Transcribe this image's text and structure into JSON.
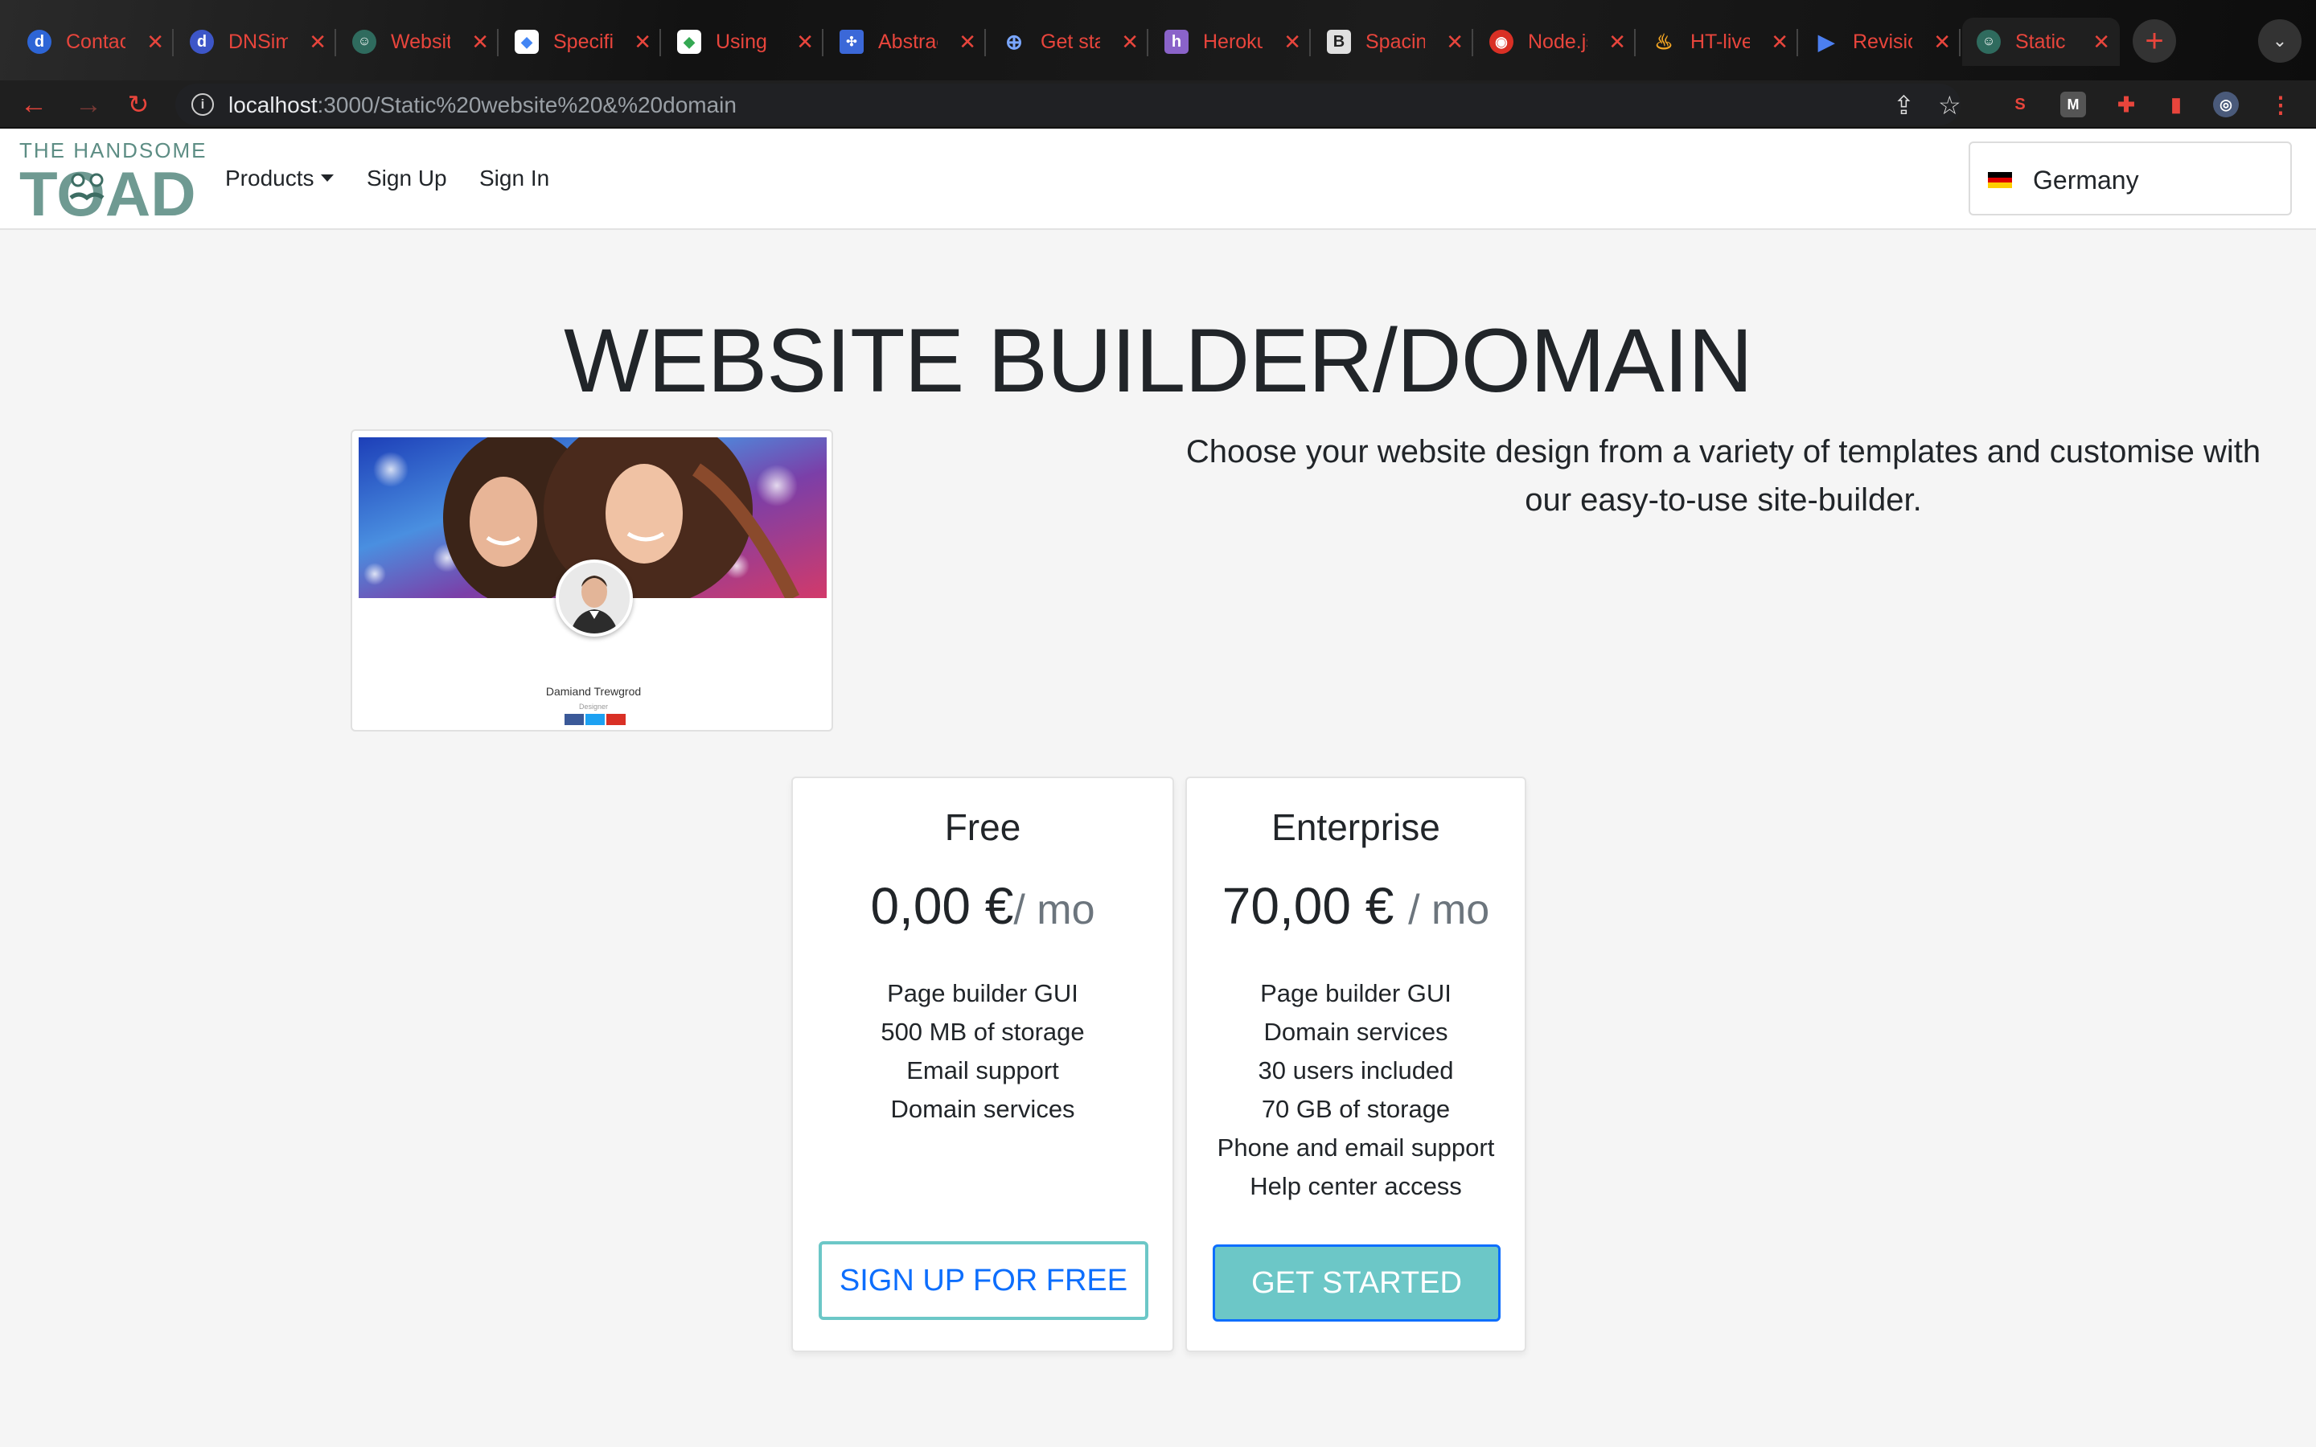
{
  "browser": {
    "tabs": [
      {
        "title": "Contact",
        "favicon": "d",
        "favicon_color": "#2d65d6"
      },
      {
        "title": "DNSimple",
        "favicon": "d",
        "favicon_color": "#3d56c8"
      },
      {
        "title": "Website",
        "favicon": "toad",
        "favicon_color": "#2f6b5e"
      },
      {
        "title": "Specification",
        "favicon": "g",
        "favicon_color": "#ffffff"
      },
      {
        "title": "Using",
        "favicon": "g",
        "favicon_color": "#ffffff"
      },
      {
        "title": "Abstract",
        "favicon": "grid",
        "favicon_color": "#3b68d8"
      },
      {
        "title": "Get started",
        "favicon": "target",
        "favicon_color": "#7aa7ff"
      },
      {
        "title": "Heroku",
        "favicon": "h",
        "favicon_color": "#8a63c9"
      },
      {
        "title": "Spacing",
        "favicon": "B",
        "favicon_color": "#e0e0e0"
      },
      {
        "title": "Node.js",
        "favicon": "globe",
        "favicon_color": "#d93025"
      },
      {
        "title": "HT-live",
        "favicon": "flame",
        "favicon_color": "#f5a623"
      },
      {
        "title": "Revisions",
        "favicon": "play",
        "favicon_color": "#4c7ff0"
      },
      {
        "title": "Static",
        "favicon": "toad",
        "favicon_color": "#2f6b5e"
      }
    ],
    "new_tab_symbol": "+",
    "tab_menu_symbol": "⌄",
    "url_host": "localhost",
    "url_rest": ":3000/Static%20website%20&%20domain",
    "info_symbol": "i"
  },
  "site": {
    "logo_tagline": "THE HANDSOME",
    "logo_word": "TOAD",
    "nav": {
      "products": "Products",
      "sign_up": "Sign Up",
      "sign_in": "Sign In"
    },
    "country": "Germany"
  },
  "hero": {
    "title": "WEBSITE BUILDER/DOMAIN",
    "description": "Choose your website design from a variety of templates and customise with our easy-to-use site-builder."
  },
  "preview": {
    "name": "Damiand Trewgrod",
    "role": "Designer"
  },
  "plans": [
    {
      "name": "Free",
      "price": "0,00 €",
      "period": "/ mo",
      "features": [
        "Page builder GUI",
        "500 MB of storage",
        "Email support",
        "Domain services"
      ],
      "cta": "SIGN UP FOR FREE"
    },
    {
      "name": "Enterprise",
      "price": "70,00 €",
      "period": "/ mo",
      "features": [
        "Page builder GUI",
        "Domain services",
        "30 users included",
        "70 GB of storage",
        "Phone and email support",
        "Help center access"
      ],
      "cta": "GET STARTED"
    }
  ],
  "colors": {
    "accent": "#6cc7c7",
    "link_blue": "#0d6efd",
    "logo_green": "#5d8d84",
    "browser_icon_red": "#e8453c"
  }
}
